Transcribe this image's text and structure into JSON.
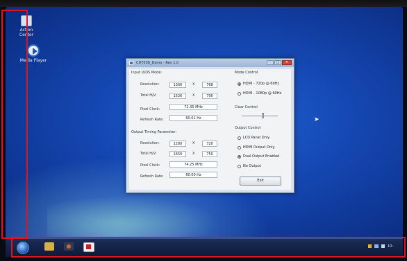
{
  "desktop": {
    "icons": [
      {
        "label": "Action\nCenter",
        "icon": "action-center-icon"
      },
      {
        "label": "Media Player",
        "icon": "media-player-icon"
      }
    ]
  },
  "window": {
    "title": "CH7036_Demo - Rev 1.0",
    "controls": {
      "minimize": "–",
      "maximize": "□",
      "close": "✕"
    },
    "input_lvds": {
      "title": "Input LVDS Mode:",
      "resolution_label": "Resolution:",
      "resolution_w": "1366",
      "resolution_h": "768",
      "total_hv_label": "Total H/V:",
      "total_h": "1526",
      "total_v": "790",
      "pixel_clock_label": "Pixel Clock:",
      "pixel_clock": "72.35 MHz",
      "refresh_label": "Refresh Rate:",
      "refresh": "60.01 Hz",
      "x_sep": "X"
    },
    "output_timing": {
      "title": "Output Timing Parameter:",
      "resolution_label": "Resolution:",
      "resolution_w": "1280",
      "resolution_h": "720",
      "total_hv_label": "Total H/V:",
      "total_h": "1650",
      "total_v": "750",
      "pixel_clock_label": "Pixel Clock:",
      "pixel_clock": "74.25 MHz",
      "refresh_label": "Refresh Rate:",
      "refresh": "60.00 Hz",
      "x_sep": "X"
    },
    "mode_control": {
      "title": "Mode Control",
      "options": [
        {
          "label": "HDMI - 720p @ 60Hz",
          "selected": true
        },
        {
          "label": "HDMI - 1080p @ 60Hz",
          "selected": false
        }
      ]
    },
    "clear_control": {
      "title": "Clear Control"
    },
    "output_control": {
      "title": "Output Control",
      "options": [
        {
          "label": "LCD Panel Only",
          "selected": false
        },
        {
          "label": "HDMI Output Only",
          "selected": false
        },
        {
          "label": "Dual Output Enabled",
          "selected": true
        },
        {
          "label": "No Output",
          "selected": false
        }
      ]
    },
    "exit_label": "Exit"
  },
  "taskbar": {
    "items": [
      "start-orb",
      "explorer-folder-icon",
      "media-player-icon",
      "demo-app-icon"
    ],
    "tray_time": "10:"
  },
  "annotation_color": "#e0141e"
}
